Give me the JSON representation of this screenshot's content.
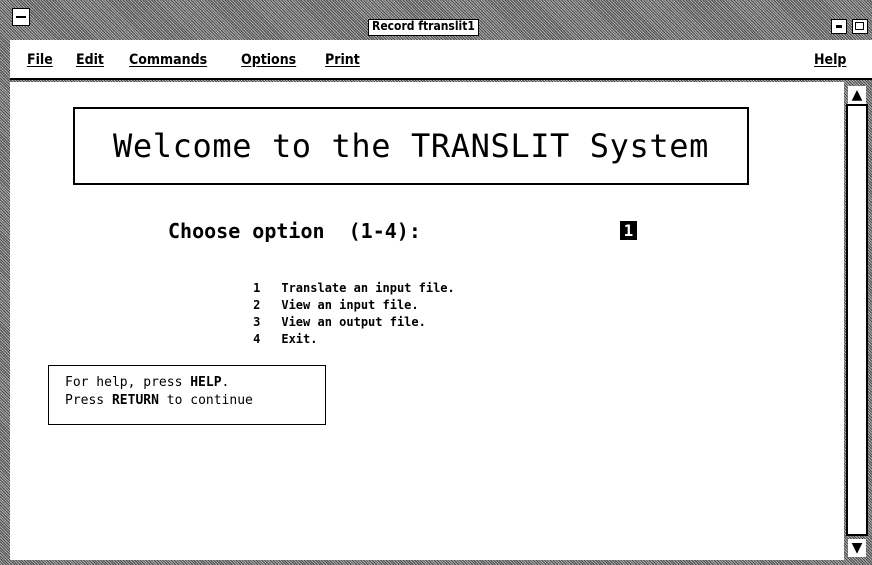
{
  "window": {
    "title": "Record ftranslit1"
  },
  "menubar": {
    "items": [
      {
        "label": "File"
      },
      {
        "label": "Edit"
      },
      {
        "label": "Commands"
      },
      {
        "label": "Options"
      },
      {
        "label": "Print"
      }
    ],
    "help_label": "Help"
  },
  "content": {
    "welcome": "Welcome to the TRANSLIT System",
    "prompt": "Choose option  (1-4):",
    "choice_value": "1",
    "options": [
      {
        "num": "1",
        "label": "Translate an input file."
      },
      {
        "num": "2",
        "label": "View an input file."
      },
      {
        "num": "3",
        "label": "View an output file."
      },
      {
        "num": "4",
        "label": "Exit."
      }
    ],
    "help": {
      "line1_prefix": "For help, press ",
      "line1_key": "HELP",
      "line1_suffix": ".",
      "line2_prefix": "Press ",
      "line2_key": "RETURN",
      "line2_suffix": " to continue"
    }
  },
  "icons": {
    "system_menu": "system-menu-icon",
    "minimize": "minimize-icon",
    "maximize": "maximize-icon",
    "scroll_up": "scroll-up-arrow-icon",
    "scroll_down": "scroll-down-arrow-icon"
  },
  "colors": {
    "foreground": "#000000",
    "background": "#ffffff",
    "frame": "#9a9a9a"
  }
}
